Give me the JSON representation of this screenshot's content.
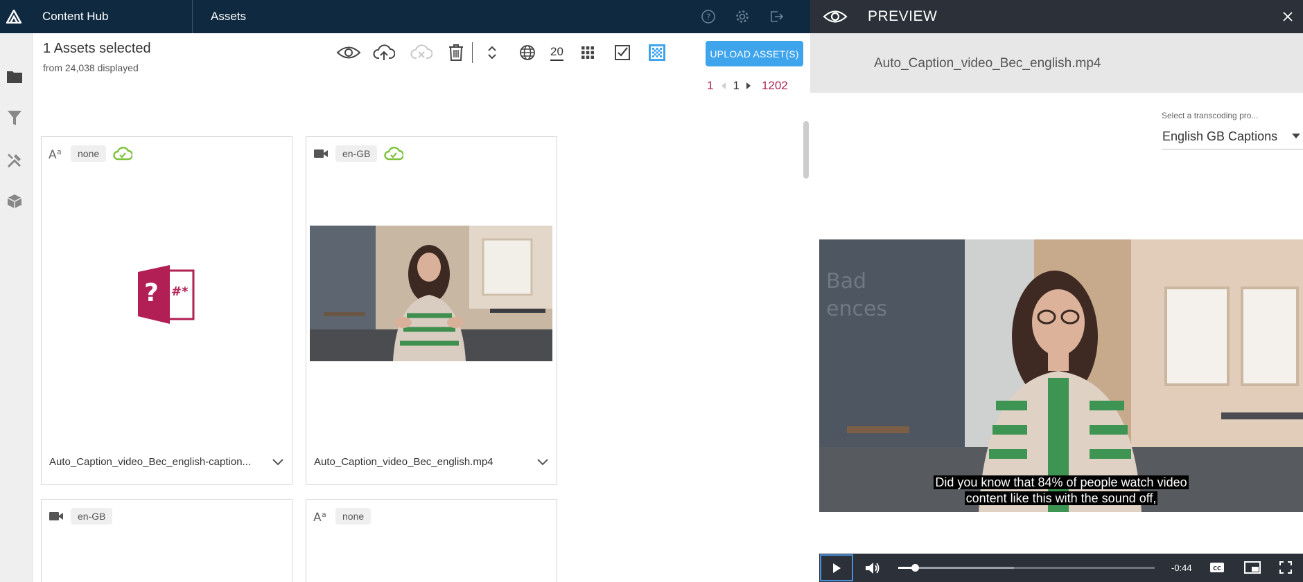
{
  "app": {
    "title": "Content Hub",
    "section": "Assets"
  },
  "topbar": {
    "icons": [
      "help-icon",
      "settings-icon",
      "logout-icon"
    ]
  },
  "siderail": {
    "icons": [
      "folder-icon",
      "filter-icon",
      "tools-icon",
      "package-icon"
    ]
  },
  "selection": {
    "title": "1 Assets selected",
    "subtitle": "from 24,038 displayed"
  },
  "toolbar": {
    "icons": [
      "preview-eye-icon",
      "upload-cloud-icon",
      "cloud-delete-icon",
      "trash-icon",
      "sort-icon",
      "globe-icon",
      "grid-icon",
      "select-all-icon",
      "select-pattern-icon"
    ],
    "page_size": "20",
    "upload_label": "UPLOAD ASSET(S)"
  },
  "pager": {
    "current": "1",
    "page": "1",
    "last": "1202"
  },
  "cards": [
    {
      "type_icon": "text-format-icon",
      "lang": "none",
      "cloud": true,
      "name": "Auto_Caption_video_Bec_english-caption...",
      "thumb": "unknown-file-icon"
    },
    {
      "type_icon": "video-camera-icon",
      "lang": "en-GB",
      "cloud": true,
      "name": "Auto_Caption_video_Bec_english.mp4",
      "thumb": "video-thumbnail"
    },
    {
      "type_icon": "video-camera-icon",
      "lang": "en-GB",
      "cloud": false,
      "name": ""
    },
    {
      "type_icon": "text-format-icon",
      "lang": "none",
      "cloud": false,
      "name": ""
    }
  ],
  "preview": {
    "title": "PREVIEW",
    "file_name": "Auto_Caption_video_Bec_english.mp4",
    "transcode_label": "Select a transcoding pro...",
    "transcode_value": "English GB Captions",
    "caption_lines": [
      "Did you know that 84% of people watch video",
      "content like this with the sound off,"
    ],
    "time_remaining": "-0:44",
    "progress": 0.065,
    "buffered": 0.45
  },
  "colors": {
    "topbar": "#0f2a40",
    "accent": "#3ea4ec",
    "pager_active": "#b0234f",
    "cloud": "#7cc23a",
    "preview_header": "#2b3039"
  }
}
